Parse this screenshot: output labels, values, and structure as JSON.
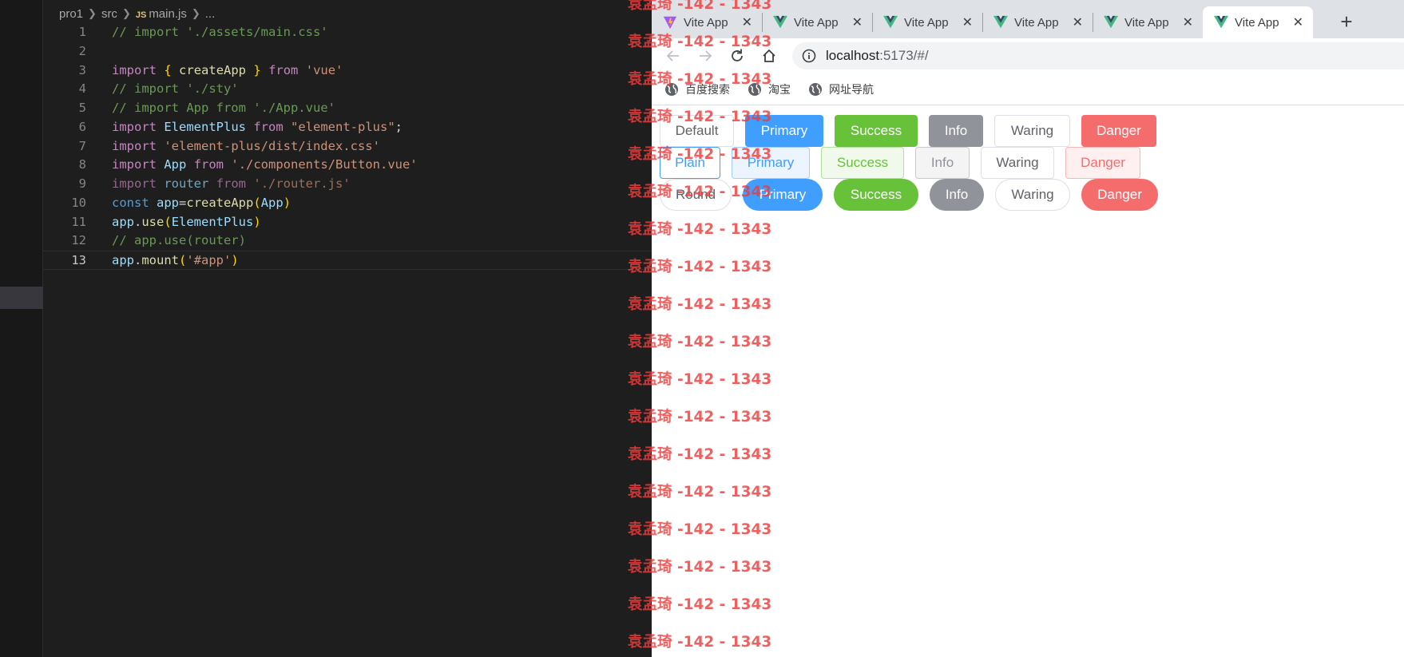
{
  "editor": {
    "breadcrumb": {
      "folder": "pro1",
      "subfolder": "src",
      "file_badge": "JS",
      "file": "main.js",
      "more": "..."
    },
    "lines": [
      {
        "n": "1"
      },
      {
        "n": "2"
      },
      {
        "n": "3"
      },
      {
        "n": "4"
      },
      {
        "n": "5"
      },
      {
        "n": "6"
      },
      {
        "n": "7"
      },
      {
        "n": "8"
      },
      {
        "n": "9"
      },
      {
        "n": "10"
      },
      {
        "n": "11"
      },
      {
        "n": "12"
      },
      {
        "n": "13"
      }
    ],
    "code": {
      "l1": "// import './assets/main.css'",
      "l3": {
        "import": "import",
        "open": "{",
        "name": "createApp",
        "close": "}",
        "from": "from",
        "src": "'vue'"
      },
      "l4": "// import './sty'",
      "l5": "// import App from './App.vue'",
      "l6": {
        "import": "import",
        "name": "ElementPlus",
        "from": "from",
        "src": "\"element-plus\"",
        "end": ";"
      },
      "l7": {
        "import": "import",
        "src": "'element-plus/dist/index.css'"
      },
      "l8": {
        "import": "import",
        "name": "App",
        "from": "from",
        "src": "'./components/Button.vue'"
      },
      "l9": {
        "import": "import",
        "name": "router",
        "from": "from",
        "src": "'./router.js'"
      },
      "l10": {
        "const": "const",
        "name": "app",
        "eq": "=",
        "fn": "createApp",
        "open": "(",
        "arg": "App",
        "close": ")"
      },
      "l11": {
        "obj": "app",
        "dot": ".",
        "fn": "use",
        "open": "(",
        "arg": "ElementPlus",
        "close": ")"
      },
      "l12": "// app.use(router)",
      "l13": {
        "obj": "app",
        "dot": ".",
        "fn": "mount",
        "open": "(",
        "arg": "'#app'",
        "close": ")"
      }
    }
  },
  "browser": {
    "tabs": [
      {
        "title": "Vite App",
        "icon": "vite-icon"
      },
      {
        "title": "Vite App",
        "icon": "vue-icon"
      },
      {
        "title": "Vite App",
        "icon": "vue-icon"
      },
      {
        "title": "Vite App",
        "icon": "vue-icon"
      },
      {
        "title": "Vite App",
        "icon": "vue-icon"
      },
      {
        "title": "Vite App",
        "icon": "vue-icon",
        "active": true
      }
    ],
    "close_glyph": "✕",
    "new_tab_glyph": "+",
    "url": {
      "host": "localhost",
      "rest": ":5173/#/"
    },
    "bookmarks": [
      "百度搜索",
      "淘宝",
      "网址导航"
    ],
    "button_rows": {
      "row1": [
        "Default",
        "Primary",
        "Success",
        "Info",
        "Waring",
        "Danger"
      ],
      "row2": [
        "Plain",
        "Primary",
        "Success",
        "Info",
        "Waring",
        "Danger"
      ],
      "row3": [
        "Round",
        "Primary",
        "Success",
        "Info",
        "Waring",
        "Danger"
      ]
    },
    "colors": {
      "primary": "#409eff",
      "success": "#67c23a",
      "info": "#909399",
      "danger": "#f56c6c"
    }
  },
  "watermark": {
    "text": "袁孟琦 -142 - 1343",
    "color": "#f03c3c"
  }
}
